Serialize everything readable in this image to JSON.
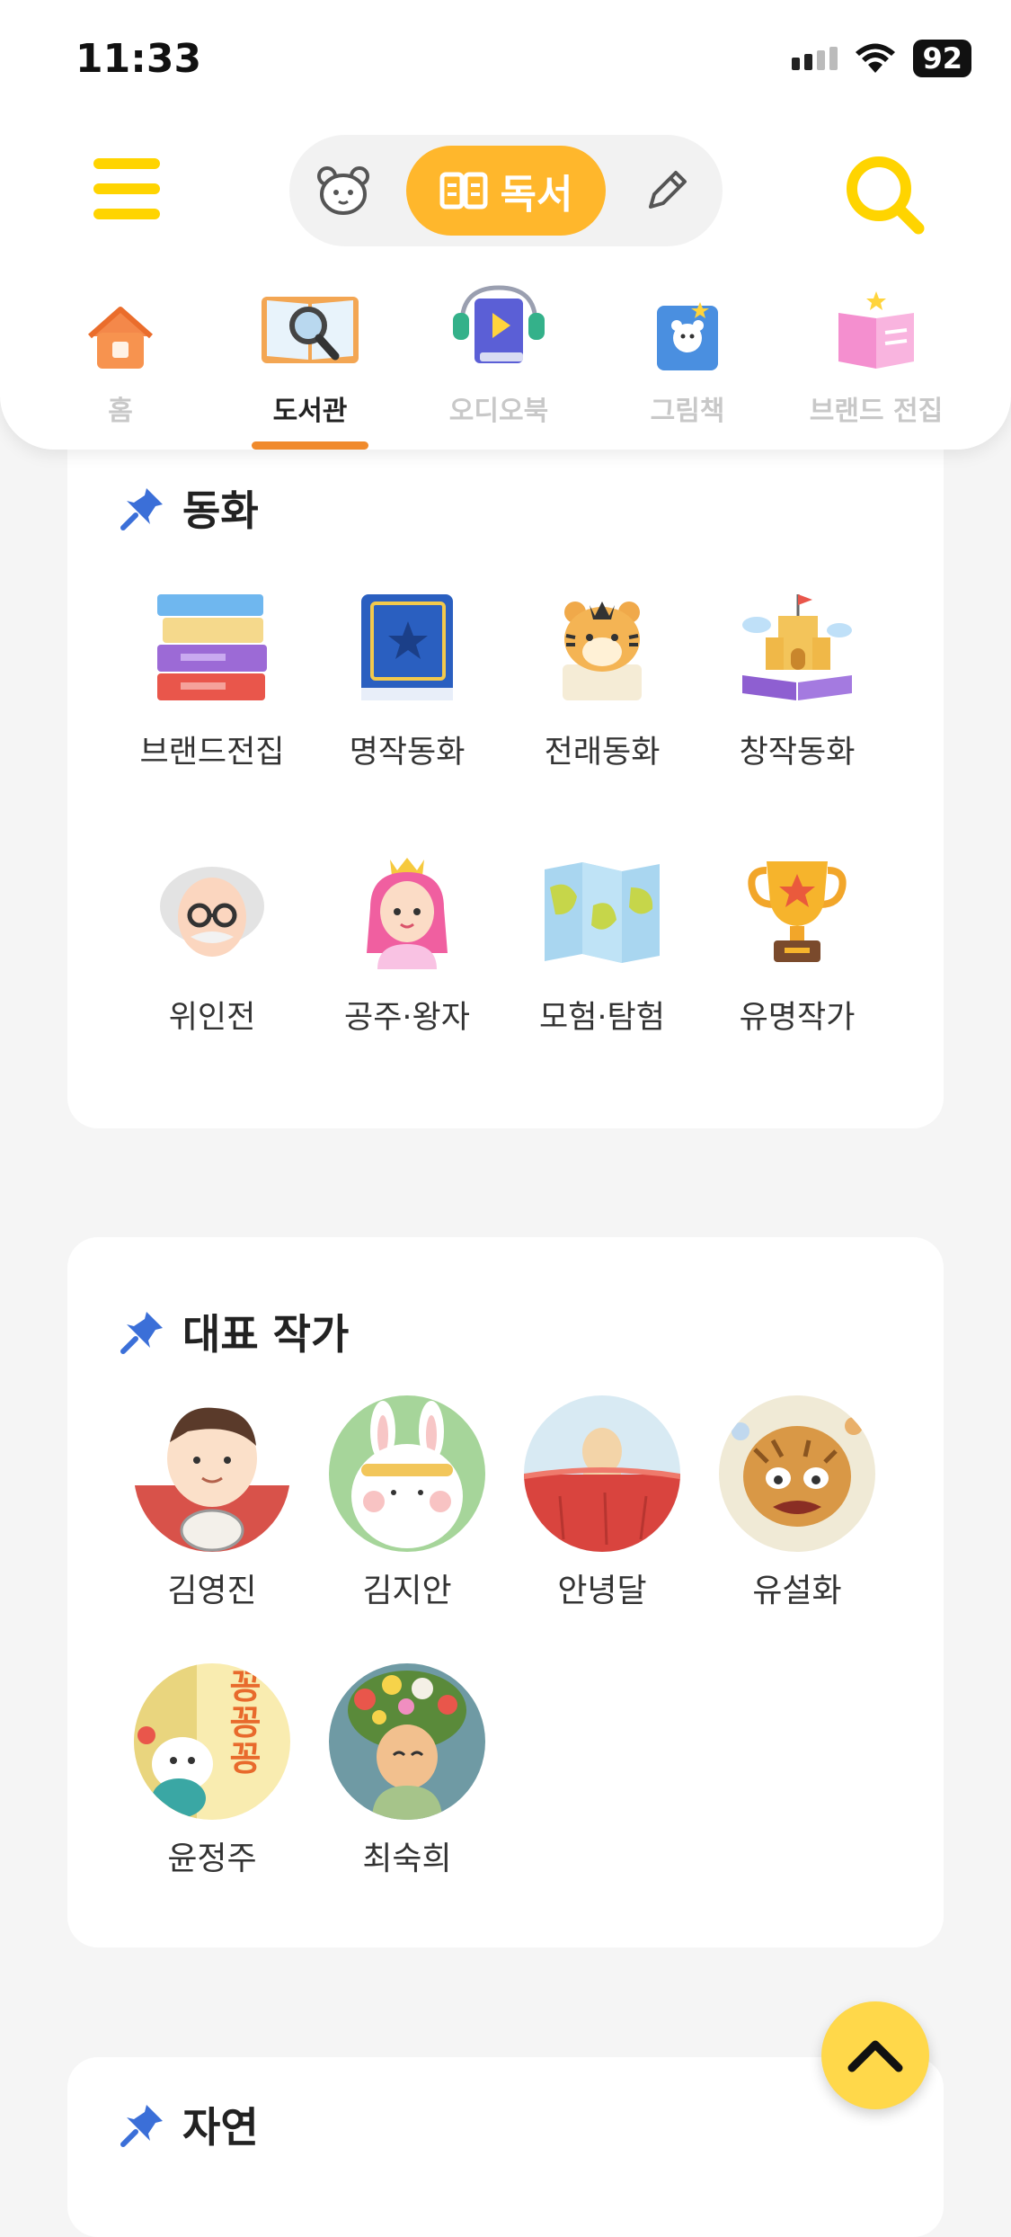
{
  "status_bar": {
    "time": "11:33",
    "battery": "92"
  },
  "header": {
    "mode_active_label": "독서",
    "tabs": [
      {
        "label": "홈",
        "icon": "house-icon"
      },
      {
        "label": "도서관",
        "icon": "library-book-icon",
        "active": true
      },
      {
        "label": "오디오북",
        "icon": "audiobook-icon"
      },
      {
        "label": "그림책",
        "icon": "picture-book-icon"
      },
      {
        "label": "브랜드 전집",
        "icon": "brand-book-icon"
      }
    ]
  },
  "sections": {
    "fairy_tale": {
      "title": "동화",
      "items": [
        {
          "label": "브랜드전집",
          "icon": "stacked-books-icon"
        },
        {
          "label": "명작동화",
          "icon": "star-book-icon"
        },
        {
          "label": "전래동화",
          "icon": "tiger-icon"
        },
        {
          "label": "창작동화",
          "icon": "castle-book-icon"
        },
        {
          "label": "위인전",
          "icon": "scientist-icon"
        },
        {
          "label": "공주·왕자",
          "icon": "princess-icon"
        },
        {
          "label": "모험·탐험",
          "icon": "map-icon"
        },
        {
          "label": "유명작가",
          "icon": "trophy-icon"
        }
      ]
    },
    "authors": {
      "title": "대표 작가",
      "items": [
        {
          "label": "김영진"
        },
        {
          "label": "김지안"
        },
        {
          "label": "안녕달"
        },
        {
          "label": "유설화"
        },
        {
          "label": "윤정주",
          "art_text": "꽁꽁꽁"
        },
        {
          "label": "최숙희"
        }
      ]
    },
    "nature": {
      "title": "자연"
    }
  },
  "colors": {
    "accent_yellow": "#ffd400",
    "mode_orange": "#ffb72c",
    "tab_indicator": "#f08a2c",
    "pin_blue": "#3b6fd8"
  }
}
